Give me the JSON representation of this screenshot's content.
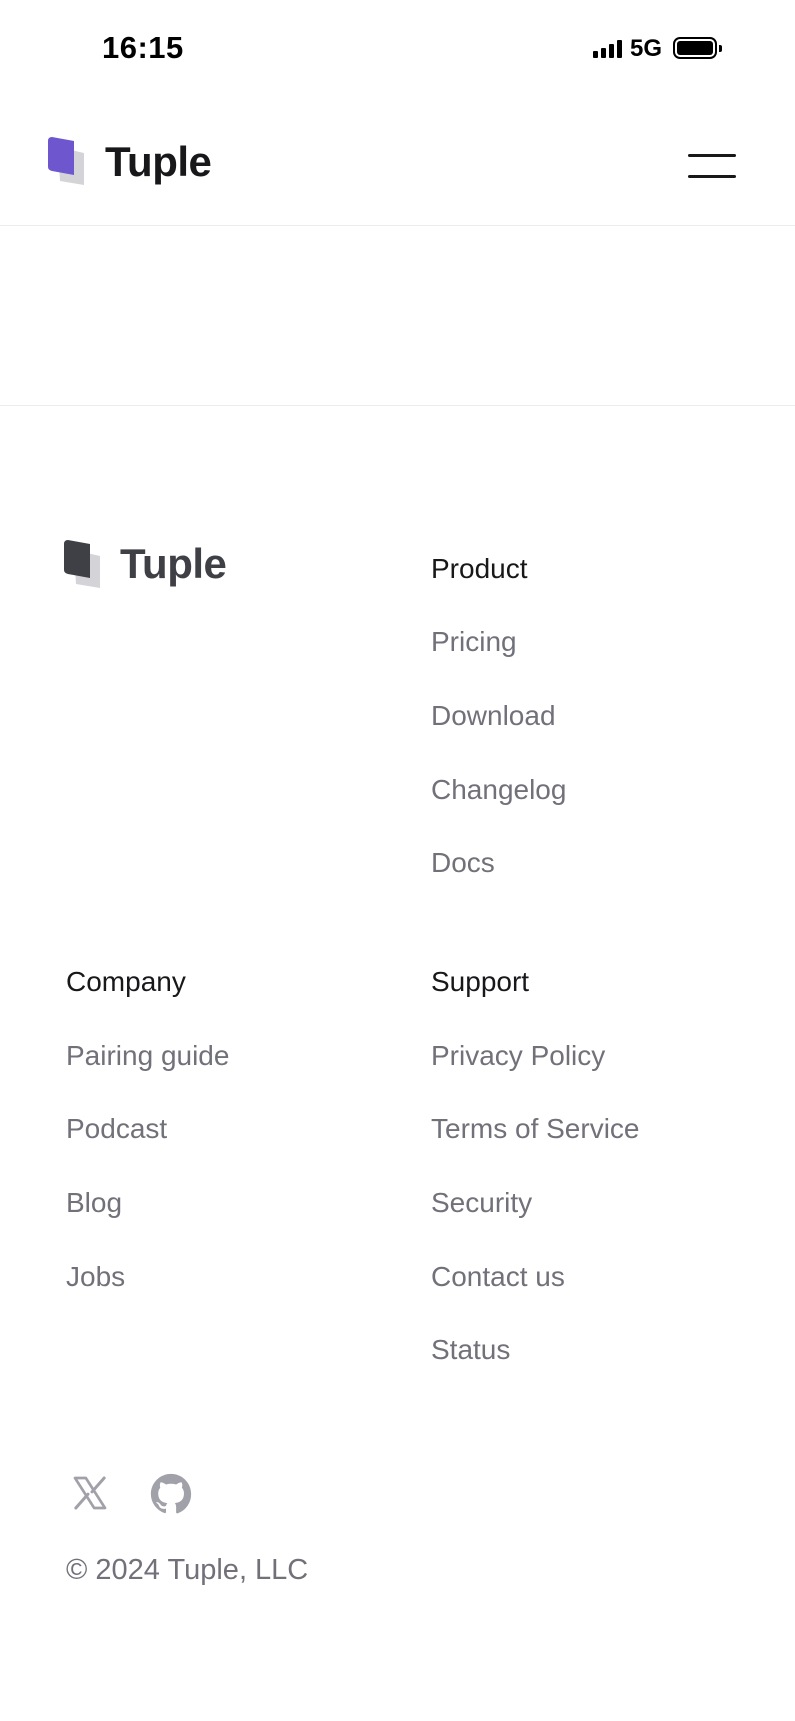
{
  "status_bar": {
    "time": "16:15",
    "network": "5G",
    "icons": [
      "signal-bars-icon",
      "battery-icon"
    ]
  },
  "header": {
    "brand": "Tuple",
    "logo_icon": "tuple-logo-icon",
    "menu_icon": "hamburger-menu-icon",
    "accent_color": "#6e56cf"
  },
  "footer": {
    "brand": "Tuple",
    "columns": {
      "product": {
        "heading": "Product",
        "links": [
          "Pricing",
          "Download",
          "Changelog",
          "Docs"
        ]
      },
      "company": {
        "heading": "Company",
        "links": [
          "Pairing guide",
          "Podcast",
          "Blog",
          "Jobs"
        ]
      },
      "support": {
        "heading": "Support",
        "links": [
          "Privacy Policy",
          "Terms of Service",
          "Security",
          "Contact us",
          "Status"
        ]
      }
    },
    "social": [
      "x-icon",
      "github-icon"
    ],
    "copyright": "© 2024 Tuple, LLC"
  }
}
